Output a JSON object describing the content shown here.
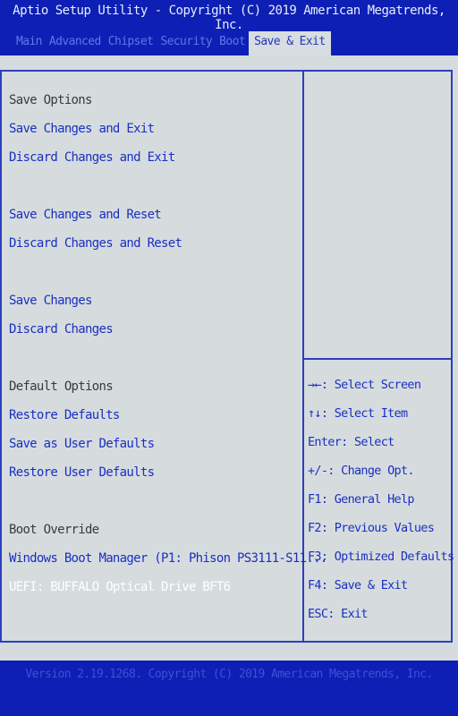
{
  "title": "Aptio Setup Utility - Copyright (C) 2019 American Megatrends, Inc.",
  "tabs": [
    {
      "label": "Main"
    },
    {
      "label": "Advanced"
    },
    {
      "label": "Chipset"
    },
    {
      "label": "Security"
    },
    {
      "label": "Boot"
    },
    {
      "label": "Save & Exit",
      "active": true
    }
  ],
  "menu": {
    "save_options_header": "Save Options",
    "save_changes_and_exit": "Save Changes and Exit",
    "discard_changes_and_exit": "Discard Changes and Exit",
    "save_changes_and_reset": "Save Changes and Reset",
    "discard_changes_and_reset": "Discard Changes and Reset",
    "save_changes": "Save Changes",
    "discard_changes": "Discard Changes",
    "default_options_header": "Default Options",
    "restore_defaults": "Restore Defaults",
    "save_as_user_defaults": "Save as User Defaults",
    "restore_user_defaults": "Restore User Defaults",
    "boot_override_header": "Boot Override",
    "boot_option_1": "Windows Boot Manager (P1: Phison PS3111-S11...",
    "boot_option_2": "UEFI: BUFFALO Optical Drive BFT6"
  },
  "help": {
    "select_screen": "→←: Select Screen",
    "select_item": "↑↓: Select Item",
    "enter_select": "Enter: Select",
    "change_opt": "+/-: Change Opt.",
    "general_help": "F1: General Help",
    "previous_values": "F2: Previous Values",
    "optimized_defaults": "F3: Optimized Defaults",
    "save_exit": "F4: Save & Exit",
    "esc_exit": "ESC: Exit"
  },
  "footer": "Version 2.19.1268. Copyright (C) 2019 American Megatrends, Inc."
}
